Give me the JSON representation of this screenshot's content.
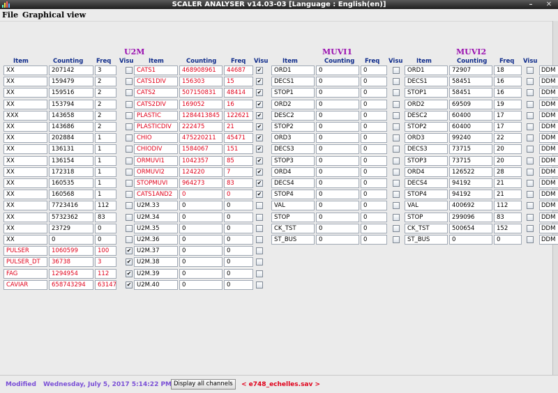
{
  "window": {
    "title": "SCALER ANALYSER v14.03-03 [Language : English(en)]",
    "minimize_glyph": "–",
    "close_glyph": "✕"
  },
  "menu": {
    "file": "File",
    "graphical_view": "Graphical view"
  },
  "headers": {
    "item": "Item",
    "counting": "Counting",
    "freq": "Freq",
    "visu": "Visu"
  },
  "groups": {
    "g1": "U2M",
    "g2": "MUVI1",
    "g3": "MUVI2"
  },
  "colors": {
    "title_purple": "#9a10b0",
    "header_blue": "#0d2a8a",
    "red_text": "#e0001a",
    "status_purple": "#7a4fd6"
  },
  "check_glyph": "✔",
  "col0": [
    {
      "item": "XX",
      "count": "207142",
      "freq": "3",
      "visu": false,
      "red": false
    },
    {
      "item": "XX",
      "count": "159479",
      "freq": "2",
      "visu": false,
      "red": false
    },
    {
      "item": "XX",
      "count": "159516",
      "freq": "2",
      "visu": false,
      "red": false
    },
    {
      "item": "XX",
      "count": "153794",
      "freq": "2",
      "visu": false,
      "red": false
    },
    {
      "item": "XXX",
      "count": "143658",
      "freq": "2",
      "visu": false,
      "red": false
    },
    {
      "item": "XX",
      "count": "143686",
      "freq": "2",
      "visu": false,
      "red": false
    },
    {
      "item": "XX",
      "count": "202884",
      "freq": "1",
      "visu": false,
      "red": false
    },
    {
      "item": "XX",
      "count": "136131",
      "freq": "1",
      "visu": false,
      "red": false
    },
    {
      "item": "XX",
      "count": "136154",
      "freq": "1",
      "visu": false,
      "red": false
    },
    {
      "item": "XX",
      "count": "172318",
      "freq": "1",
      "visu": false,
      "red": false
    },
    {
      "item": "XX",
      "count": "160535",
      "freq": "1",
      "visu": false,
      "red": false
    },
    {
      "item": "XX",
      "count": "160568",
      "freq": "1",
      "visu": false,
      "red": false
    },
    {
      "item": "XX",
      "count": "7723416",
      "freq": "112",
      "visu": false,
      "red": false
    },
    {
      "item": "XX",
      "count": "5732362",
      "freq": "83",
      "visu": false,
      "red": false
    },
    {
      "item": "XX",
      "count": "23729",
      "freq": "0",
      "visu": false,
      "red": false
    },
    {
      "item": "XX",
      "count": "0",
      "freq": "0",
      "visu": false,
      "red": false
    },
    {
      "item": "PULSER",
      "count": "1060599",
      "freq": "100",
      "visu": true,
      "red": true
    },
    {
      "item": "PULSER_DT",
      "count": "36738",
      "freq": "3",
      "visu": true,
      "red": true
    },
    {
      "item": "FAG",
      "count": "1294954",
      "freq": "112",
      "visu": true,
      "red": true
    },
    {
      "item": "CAVIAR",
      "count": "658743294",
      "freq": "63147",
      "visu": true,
      "red": true
    }
  ],
  "col1": [
    {
      "item": "CATS1",
      "count": "468908961",
      "freq": "44687",
      "visu": true,
      "red": true
    },
    {
      "item": "CATS1DIV",
      "count": "156303",
      "freq": "15",
      "visu": true,
      "red": true
    },
    {
      "item": "CATS2",
      "count": "507150831",
      "freq": "48414",
      "visu": true,
      "red": true
    },
    {
      "item": "CATS2DIV",
      "count": "169052",
      "freq": "16",
      "visu": true,
      "red": true
    },
    {
      "item": "PLASTIC",
      "count": "1284413845",
      "freq": "122621",
      "visu": true,
      "red": true
    },
    {
      "item": "PLASTICDIV",
      "count": "222475",
      "freq": "21",
      "visu": true,
      "red": true
    },
    {
      "item": "CHIO",
      "count": "475220211",
      "freq": "45471",
      "visu": true,
      "red": true
    },
    {
      "item": "CHIODIV",
      "count": "1584067",
      "freq": "151",
      "visu": true,
      "red": true
    },
    {
      "item": "ORMUVI1",
      "count": "1042357",
      "freq": "85",
      "visu": true,
      "red": true
    },
    {
      "item": "ORMUVI2",
      "count": "124220",
      "freq": "7",
      "visu": true,
      "red": true
    },
    {
      "item": "STOPMUVI",
      "count": "964273",
      "freq": "83",
      "visu": true,
      "red": true
    },
    {
      "item": "CATS1AND2",
      "count": "0",
      "freq": "0",
      "visu": true,
      "red": true
    },
    {
      "item": "U2M.33",
      "count": "0",
      "freq": "0",
      "visu": false,
      "red": false
    },
    {
      "item": "U2M.34",
      "count": "0",
      "freq": "0",
      "visu": false,
      "red": false
    },
    {
      "item": "U2M.35",
      "count": "0",
      "freq": "0",
      "visu": false,
      "red": false
    },
    {
      "item": "U2M.36",
      "count": "0",
      "freq": "0",
      "visu": false,
      "red": false
    },
    {
      "item": "U2M.37",
      "count": "0",
      "freq": "0",
      "visu": false,
      "red": false
    },
    {
      "item": "U2M.38",
      "count": "0",
      "freq": "0",
      "visu": false,
      "red": false
    },
    {
      "item": "U2M.39",
      "count": "0",
      "freq": "0",
      "visu": false,
      "red": false
    },
    {
      "item": "U2M.40",
      "count": "0",
      "freq": "0",
      "visu": false,
      "red": false
    }
  ],
  "col2": [
    {
      "item": "ORD1",
      "count": "0",
      "freq": "0",
      "visu": false,
      "red": false
    },
    {
      "item": "DECS1",
      "count": "0",
      "freq": "0",
      "visu": false,
      "red": false
    },
    {
      "item": "STOP1",
      "count": "0",
      "freq": "0",
      "visu": false,
      "red": false
    },
    {
      "item": "ORD2",
      "count": "0",
      "freq": "0",
      "visu": false,
      "red": false
    },
    {
      "item": "DESC2",
      "count": "0",
      "freq": "0",
      "visu": false,
      "red": false
    },
    {
      "item": "STOP2",
      "count": "0",
      "freq": "0",
      "visu": false,
      "red": false
    },
    {
      "item": "ORD3",
      "count": "0",
      "freq": "0",
      "visu": false,
      "red": false
    },
    {
      "item": "DECS3",
      "count": "0",
      "freq": "0",
      "visu": false,
      "red": false
    },
    {
      "item": "STOP3",
      "count": "0",
      "freq": "0",
      "visu": false,
      "red": false
    },
    {
      "item": "ORD4",
      "count": "0",
      "freq": "0",
      "visu": false,
      "red": false
    },
    {
      "item": "DECS4",
      "count": "0",
      "freq": "0",
      "visu": false,
      "red": false
    },
    {
      "item": "STOP4",
      "count": "0",
      "freq": "0",
      "visu": false,
      "red": false
    },
    {
      "item": "VAL",
      "count": "0",
      "freq": "0",
      "visu": false,
      "red": false
    },
    {
      "item": "STOP",
      "count": "0",
      "freq": "0",
      "visu": false,
      "red": false
    },
    {
      "item": "CK_TST",
      "count": "0",
      "freq": "0",
      "visu": false,
      "red": false
    },
    {
      "item": "ST_BUS",
      "count": "0",
      "freq": "0",
      "visu": false,
      "red": false
    }
  ],
  "col3": [
    {
      "item": "ORD1",
      "count": "72907",
      "freq": "18",
      "visu": false,
      "red": false
    },
    {
      "item": "DECS1",
      "count": "58451",
      "freq": "16",
      "visu": false,
      "red": false
    },
    {
      "item": "STOP1",
      "count": "58451",
      "freq": "16",
      "visu": false,
      "red": false
    },
    {
      "item": "ORD2",
      "count": "69509",
      "freq": "19",
      "visu": false,
      "red": false
    },
    {
      "item": "DESC2",
      "count": "60400",
      "freq": "17",
      "visu": false,
      "red": false
    },
    {
      "item": "STOP2",
      "count": "60400",
      "freq": "17",
      "visu": false,
      "red": false
    },
    {
      "item": "ORD3",
      "count": "99240",
      "freq": "22",
      "visu": false,
      "red": false
    },
    {
      "item": "DECS3",
      "count": "73715",
      "freq": "20",
      "visu": false,
      "red": false
    },
    {
      "item": "STOP3",
      "count": "73715",
      "freq": "20",
      "visu": false,
      "red": false
    },
    {
      "item": "ORD4",
      "count": "126522",
      "freq": "28",
      "visu": false,
      "red": false
    },
    {
      "item": "DECS4",
      "count": "94192",
      "freq": "21",
      "visu": false,
      "red": false
    },
    {
      "item": "STOP4",
      "count": "94192",
      "freq": "21",
      "visu": false,
      "red": false
    },
    {
      "item": "VAL",
      "count": "400692",
      "freq": "112",
      "visu": false,
      "red": false
    },
    {
      "item": "STOP",
      "count": "299096",
      "freq": "83",
      "visu": false,
      "red": false
    },
    {
      "item": "CK_TST",
      "count": "500654",
      "freq": "152",
      "visu": false,
      "red": false
    },
    {
      "item": "ST_BUS",
      "count": "0",
      "freq": "0",
      "visu": false,
      "red": false
    }
  ],
  "partial_column_label": "DDM",
  "status": {
    "modified": "Modified",
    "datetime": "Wednesday, July 5, 2017 5:14:22 PM",
    "display_all": "Display all channels",
    "file": "< e748_echelles.sav >"
  }
}
